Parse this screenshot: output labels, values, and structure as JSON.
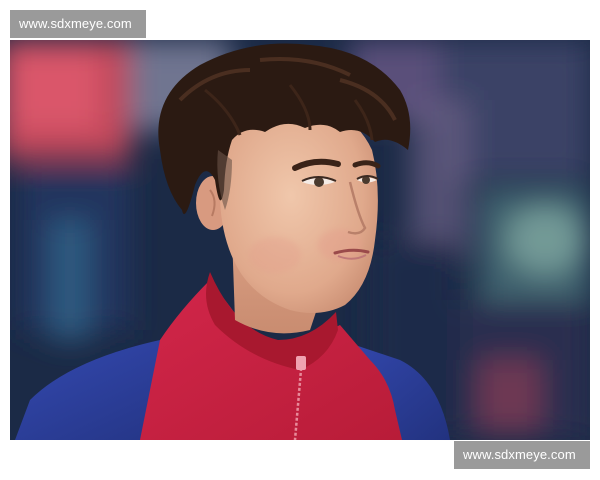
{
  "watermarks": {
    "top": "www.sdxmeye.com",
    "bottom": "www.sdxmeye.com"
  },
  "photo": {
    "subject": "young footballer portrait",
    "colors": {
      "jacket_red": "#c8233f",
      "jacket_blue": "#2c3f9c",
      "background_dark": "#1c2b47",
      "hair": "#2b1a12",
      "skin": "#e8b89c"
    }
  }
}
